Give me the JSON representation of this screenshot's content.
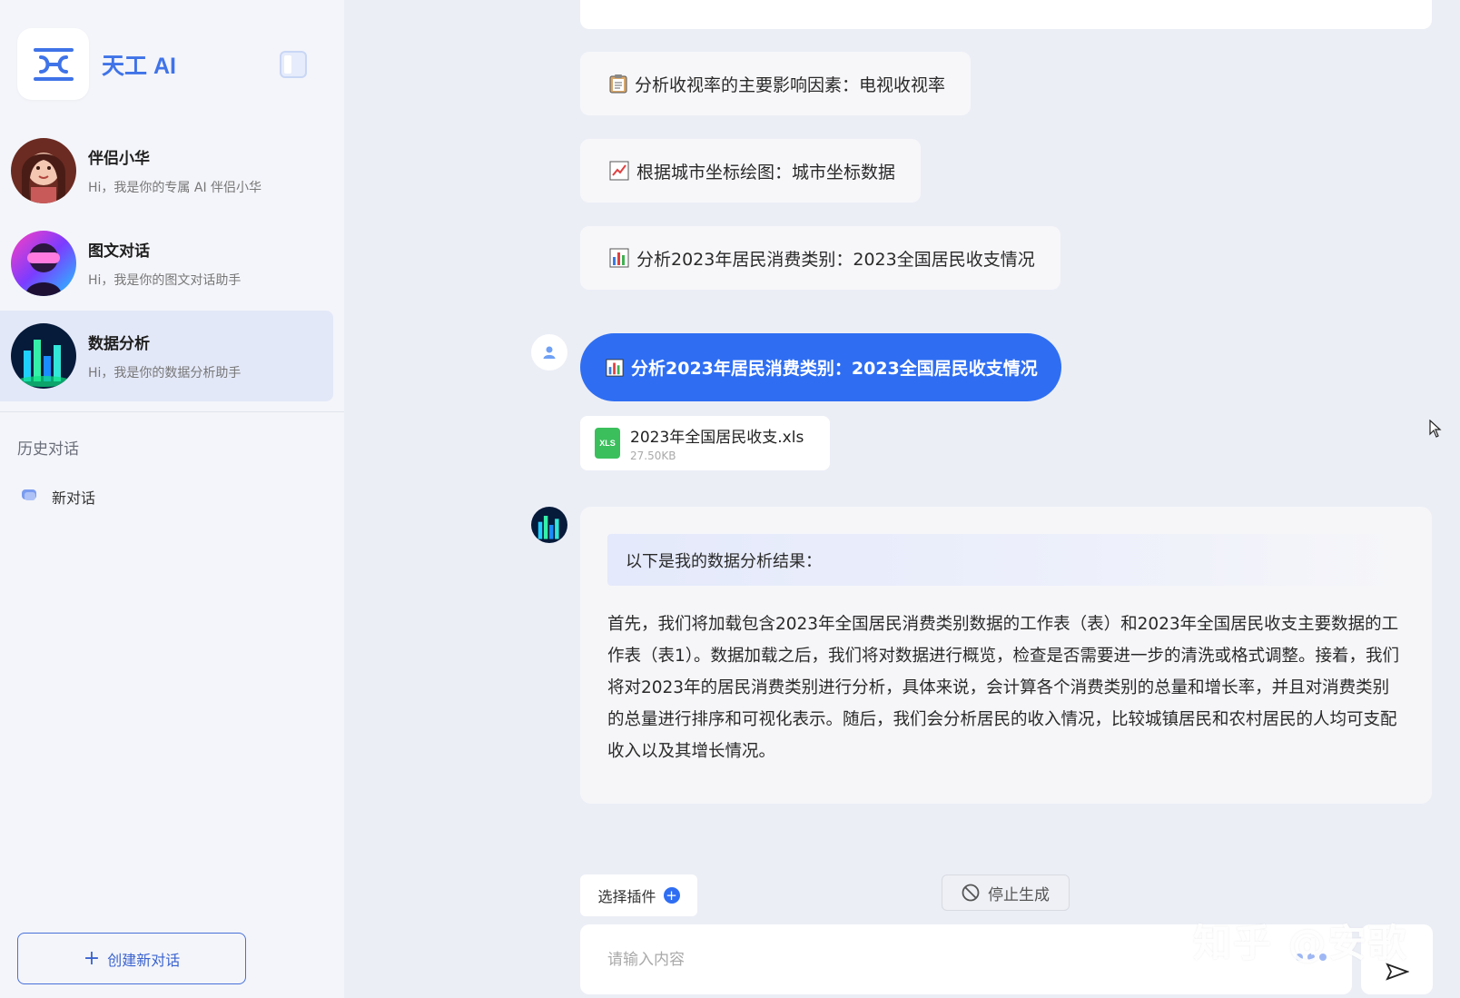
{
  "app": {
    "name": "天工 AI"
  },
  "sidebar": {
    "assistants": [
      {
        "title": "伴侣小华",
        "desc": "Hi，我是你的专属 AI 伴侣小华"
      },
      {
        "title": "图文对话",
        "desc": "Hi，我是你的图文对话助手"
      },
      {
        "title": "数据分析",
        "desc": "Hi，我是你的数据分析助手"
      }
    ],
    "history_title": "历史对话",
    "history": [
      {
        "label": "新对话"
      }
    ],
    "new_chat_label": "创建新对话"
  },
  "chat": {
    "suggestions": [
      {
        "icon": "clipboard-icon",
        "text": "分析收视率的主要影响因素：电视收视率"
      },
      {
        "icon": "line-chart-icon",
        "text": "根据城市坐标绘图：城市坐标数据"
      },
      {
        "icon": "bar-chart-icon",
        "text": "分析2023年居民消费类别：2023全国居民收支情况"
      }
    ],
    "user_message": "分析2023年居民消费类别：2023全国居民收支情况",
    "file": {
      "badge": "XLS",
      "name": "2023年全国居民收支.xls",
      "size": "27.50KB"
    },
    "answer": {
      "heading": "以下是我的数据分析结果：",
      "body": "首先，我们将加载包含2023年全国居民消费类别数据的工作表（表）和2023年全国居民收支主要数据的工作表（表1）。数据加载之后，我们将对数据进行概览，检查是否需要进一步的清洗或格式调整。接着，我们将对2023年的居民消费类别进行分析，具体来说，会计算各个消费类别的总量和增长率，并且对消费类别的总量进行排序和可视化表示。随后，我们会分析居民的收入情况，比较城镇居民和农村居民的人均可支配收入以及其增长情况。"
    }
  },
  "controls": {
    "plugin_label": "选择插件",
    "stop_label": "停止生成",
    "input_placeholder": "请输入内容"
  },
  "watermark": "知乎 @安歌",
  "colors": {
    "accent": "#2f6ef2",
    "brand": "#3f73e8",
    "file": "#3bbf5c"
  }
}
